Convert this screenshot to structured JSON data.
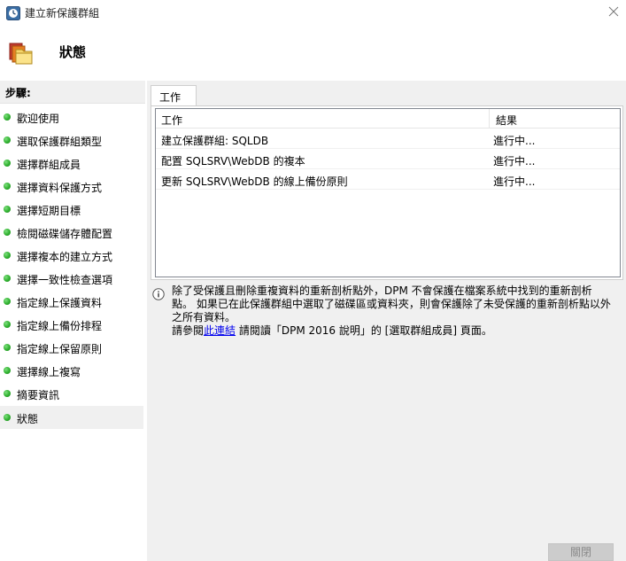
{
  "window": {
    "title": "建立新保護群組",
    "app_icon": "dpm-clock-icon",
    "close_icon": "close-icon"
  },
  "header": {
    "icon": "folder-stack-icon",
    "title": "狀態"
  },
  "steps": {
    "label": "步驟:",
    "items": [
      {
        "label": "歡迎使用"
      },
      {
        "label": "選取保護群組類型"
      },
      {
        "label": "選擇群組成員"
      },
      {
        "label": "選擇資料保護方式"
      },
      {
        "label": "選擇短期目標"
      },
      {
        "label": "檢閱磁碟儲存體配置"
      },
      {
        "label": "選擇複本的建立方式"
      },
      {
        "label": "選擇一致性檢查選項"
      },
      {
        "label": "指定線上保護資料"
      },
      {
        "label": "指定線上備份排程"
      },
      {
        "label": "指定線上保留原則"
      },
      {
        "label": "選擇線上複寫"
      },
      {
        "label": "摘要資訊"
      },
      {
        "label": "狀態"
      }
    ],
    "current": "狀態"
  },
  "main": {
    "tab_label": "工作",
    "columns": {
      "task": "工作",
      "result": "結果"
    },
    "rows": [
      {
        "task": "建立保護群組: SQLDB",
        "result": "進行中..."
      },
      {
        "task": "配置 SQLSRV\\WebDB 的複本",
        "result": "進行中..."
      },
      {
        "task": "更新 SQLSRV\\WebDB 的線上備份原則",
        "result": "進行中..."
      }
    ]
  },
  "info": {
    "icon": "info-icon",
    "line1": "除了受保護且刪除重複資料的重新剖析點外，DPM 不會保護在檔案系統中找到的重新剖析",
    "line2": "點。 如果已在此保護群組中選取了磁碟區或資料夾，則會保護除了未受保護的重新剖析點以外",
    "line3": "之所有資料。",
    "line4_prefix": "請參閱",
    "link_text": "此連結",
    "line4_suffix": " 請閱讀「DPM 2016 說明」的 [選取群組成員] 頁面。"
  },
  "footer": {
    "close_button": "關閉"
  }
}
